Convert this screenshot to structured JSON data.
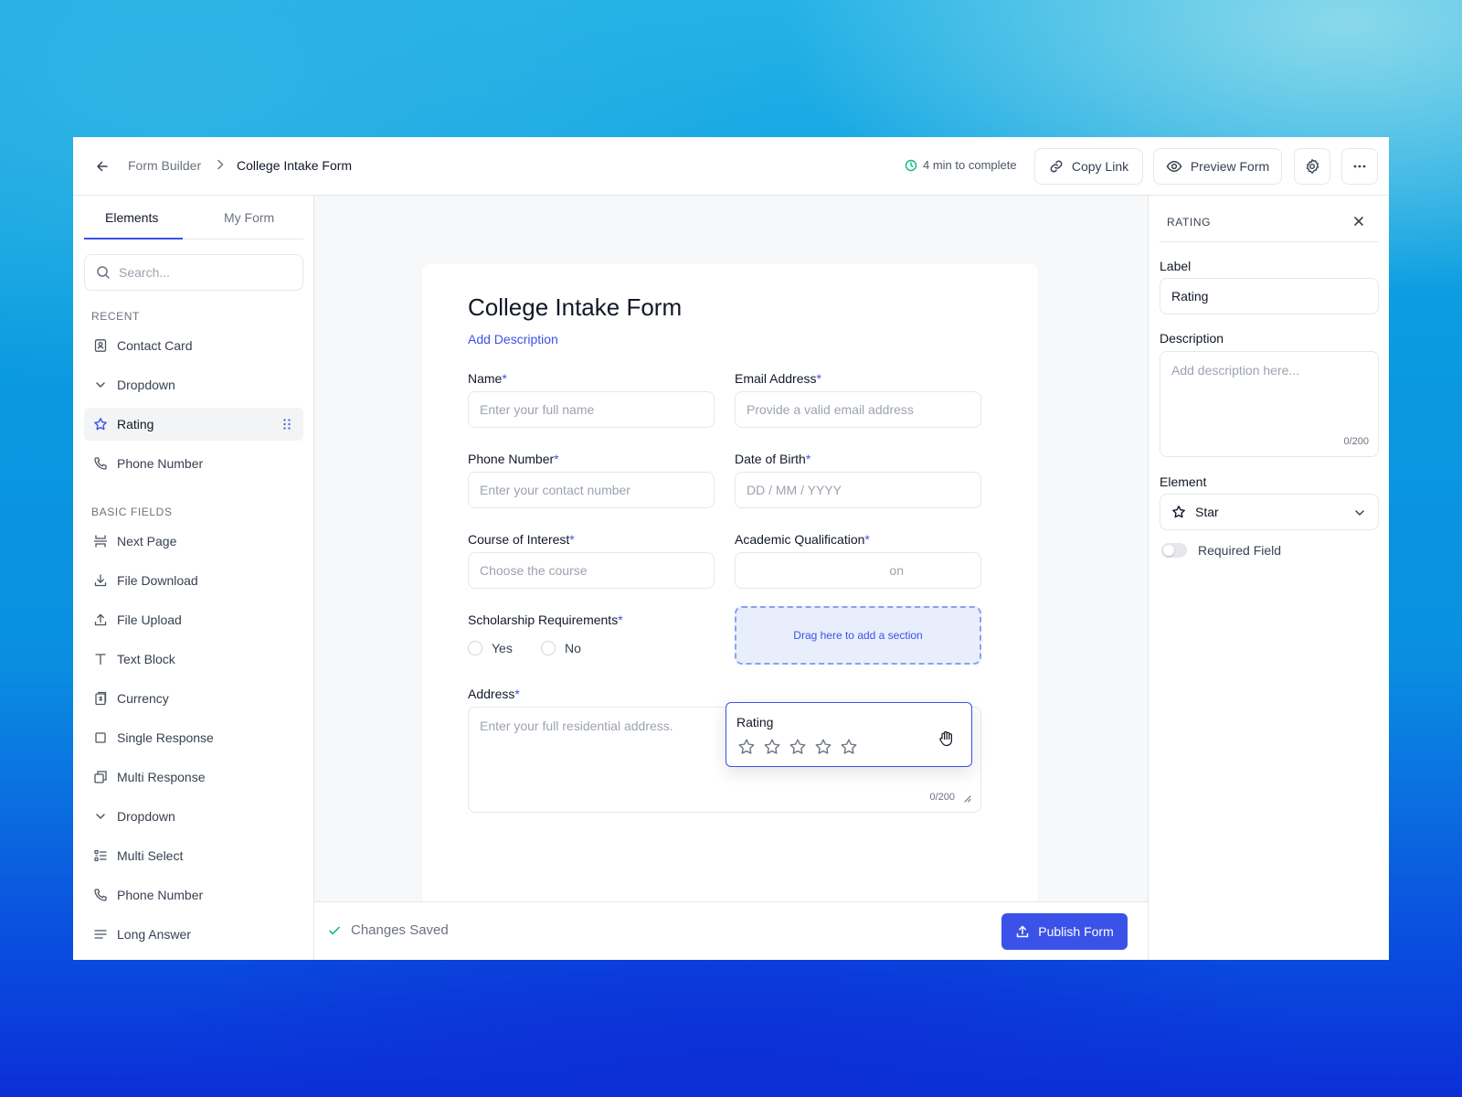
{
  "header": {
    "breadcrumb_parent": "Form Builder",
    "breadcrumb_current": "College Intake Form",
    "time_estimate": "4 min to complete",
    "copy_link_label": "Copy Link",
    "preview_label": "Preview Form"
  },
  "sidebar": {
    "tabs": [
      "Elements",
      "My Form"
    ],
    "active_tab": "Elements",
    "search_placeholder": "Search...",
    "recent_title": "RECENT",
    "recent_items": [
      {
        "label": "Contact Card",
        "icon": "contact-card-icon"
      },
      {
        "label": "Dropdown",
        "icon": "chevron-down-icon"
      },
      {
        "label": "Rating",
        "icon": "star-icon",
        "active": true
      },
      {
        "label": "Phone Number",
        "icon": "phone-icon"
      }
    ],
    "basic_title": "BASIC FIELDS",
    "basic_items": [
      {
        "label": "Next Page",
        "icon": "page-break-icon"
      },
      {
        "label": "File Download",
        "icon": "download-icon"
      },
      {
        "label": "File Upload",
        "icon": "upload-icon"
      },
      {
        "label": "Text Block",
        "icon": "text-icon"
      },
      {
        "label": "Currency",
        "icon": "currency-icon"
      },
      {
        "label": "Single Response",
        "icon": "square-icon"
      },
      {
        "label": "Multi Response",
        "icon": "copy-squares-icon"
      },
      {
        "label": "Dropdown",
        "icon": "chevron-down-icon"
      },
      {
        "label": "Multi Select",
        "icon": "list-icon"
      },
      {
        "label": "Phone Number",
        "icon": "phone-icon"
      },
      {
        "label": "Long Answer",
        "icon": "lines-icon"
      }
    ]
  },
  "form": {
    "title": "College Intake Form",
    "add_description": "Add Description",
    "required_marker": "*",
    "fields": {
      "name": {
        "label": "Name",
        "placeholder": "Enter your full name"
      },
      "email": {
        "label": "Email Address",
        "placeholder": "Provide a valid email address"
      },
      "phone": {
        "label": "Phone Number",
        "placeholder": "Enter your contact number"
      },
      "dob": {
        "label": "Date of Birth",
        "placeholder": "DD / MM / YYYY"
      },
      "course": {
        "label": "Course of Interest",
        "placeholder": "Choose the course"
      },
      "qualification": {
        "label": "Academic Qualification",
        "placeholder_visible": "on"
      },
      "scholarship": {
        "label": "Scholarship Requirements",
        "options": [
          "Yes",
          "No"
        ]
      },
      "address": {
        "label": "Address",
        "placeholder": "Enter your full residential address.",
        "counter": "0/200"
      }
    },
    "dropzone_text": "Drag here to add a section"
  },
  "dragging": {
    "label": "Rating",
    "star_count": 5
  },
  "footer": {
    "saved_text": "Changes Saved",
    "publish_label": "Publish Form"
  },
  "properties": {
    "title": "RATING",
    "label_title": "Label",
    "label_value": "Rating",
    "description_title": "Description",
    "description_placeholder": "Add description here...",
    "description_counter": "0/200",
    "element_title": "Element",
    "element_value": "Star",
    "required_label": "Required Field",
    "required_on": false
  },
  "colors": {
    "accent": "#3b52e8",
    "success": "#10b981"
  }
}
